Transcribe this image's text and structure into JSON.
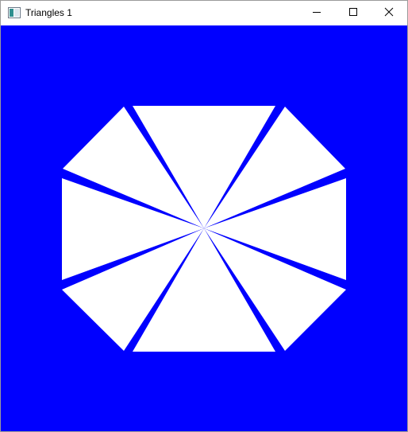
{
  "window": {
    "title": "Triangles 1",
    "icon": "app-window-icon",
    "controls": {
      "minimize_icon": "minimize-icon",
      "maximize_icon": "maximize-icon",
      "close_icon": "close-icon"
    }
  },
  "canvas": {
    "background_color": "#0000ff",
    "shape_color": "#ffffff",
    "triangle_count": 8
  }
}
